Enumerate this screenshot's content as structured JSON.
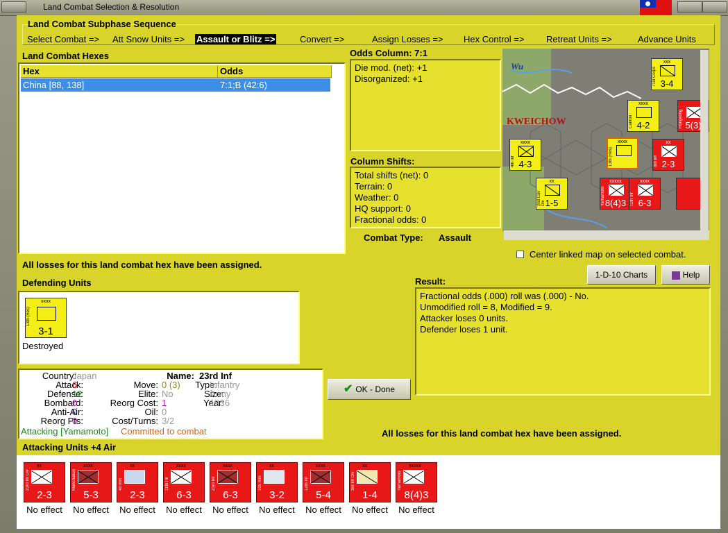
{
  "window": {
    "title": "Land Combat Selection & Resolution"
  },
  "subphase": {
    "heading": "Land Combat Subphase Sequence",
    "steps": [
      {
        "label": "Select Combat =>"
      },
      {
        "label": "Att Snow Units =>"
      },
      {
        "label": "Assault or Blitz =>",
        "active": true
      },
      {
        "label": "Convert =>"
      },
      {
        "label": "Assign Losses =>"
      },
      {
        "label": "Hex Control =>"
      },
      {
        "label": "Retreat Units =>"
      },
      {
        "label": "Advance Units"
      }
    ]
  },
  "hexes": {
    "heading": "Land Combat Hexes",
    "columns": [
      "Hex",
      "Odds"
    ],
    "rows": [
      {
        "hex": "China [88, 138]",
        "odds": "7:1;B (42:6)"
      }
    ]
  },
  "odds_column": {
    "heading": "Odds Column: 7:1",
    "lines": [
      "Die mod. (net): +1",
      "Disorganized: +1"
    ]
  },
  "column_shifts": {
    "heading": "Column Shifts:",
    "lines": [
      "Total shifts (net): 0",
      "Terrain: 0",
      "Weather: 0",
      "HQ support: 0",
      "Fractional odds: 0"
    ]
  },
  "combat_type": {
    "label": "Combat Type:",
    "value": "Assault"
  },
  "map": {
    "labels": [
      "Wu",
      "KWEICHOW"
    ],
    "counters": [
      {
        "color": "y",
        "size": "xxx",
        "name": "71st Corps",
        "str": "3-4",
        "badge": "2"
      },
      {
        "color": "y",
        "size": "xxxx",
        "name": "Canton",
        "str": "4-2",
        "badge": "2"
      },
      {
        "color": "r",
        "size": "",
        "name": "Hongkong",
        "str": "5(3)",
        "badge": "2"
      },
      {
        "color": "y",
        "size": "xxxx",
        "name": "4th Inf",
        "str": "4-3",
        "badge": ""
      },
      {
        "color": "y",
        "size": "xxxx",
        "name": "13th (Res)",
        "str": "",
        "badge": "3"
      },
      {
        "color": "r",
        "size": "xx",
        "name": "3rd Inf",
        "str": "2-3",
        "badge": ""
      },
      {
        "color": "y",
        "size": "xx",
        "name": "2nd Cav Div",
        "str": "1-5",
        "badge": ""
      },
      {
        "color": "r",
        "size": "xxxxx",
        "name": "Yamamoto",
        "str": "8(4)3",
        "badge": "3"
      },
      {
        "color": "r",
        "size": "xxxx",
        "name": "11th Inf",
        "str": "6-3",
        "badge": "3"
      },
      {
        "color": "r",
        "size": "",
        "name": "",
        "str": "",
        "badge": "2"
      }
    ],
    "center_linked_label": "Center linked map on selected combat."
  },
  "buttons": {
    "charts": "1-D-10 Charts",
    "help": "Help",
    "ok": "OK - Done"
  },
  "status_top": "All losses for this land combat hex have been assigned.",
  "status_bottom": "All losses for this land combat hex have been assigned.",
  "defending": {
    "heading": "Defending Units",
    "units": [
      {
        "size": "xxxx",
        "name": "13th (Res)",
        "str": "3-1",
        "effect": "Destroyed"
      }
    ]
  },
  "result": {
    "heading": "Result:",
    "lines": [
      "Fractional odds (.000) roll was (.000)  - No.",
      "Unmodified roll = 8, Modified = 9.",
      "Attacker loses 0 units.",
      "Defender loses 1 unit."
    ]
  },
  "unit_info": {
    "country_k": "Country:",
    "country_v": "Japan",
    "attack_k": "Attack:",
    "attack_v": "6",
    "defense_k": "Defense:",
    "defense_v": "12",
    "bombard_k": "Bombard:",
    "bombard_v": "0",
    "antiair_k": "Anti-Air:",
    "antiair_v": "0",
    "reorgpts_k": "Reorg Pts:",
    "reorgpts_v": "0",
    "name_k": "Name:",
    "name_v": "23rd Inf",
    "move_k": "Move:",
    "move_v": "0 (3)",
    "type_k": "Type:",
    "type_v": "Infantry",
    "elite_k": "Elite:",
    "elite_v": "No",
    "size_k": "Size:",
    "size_v": "Army",
    "reorgcost_k": "Reorg Cost:",
    "reorgcost_v": "1",
    "year_k": "Year:",
    "year_v": "1936",
    "oil_k": "Oil:",
    "oil_v": "0",
    "costturns_k": "Cost/Turns:",
    "costturns_v": "3/2",
    "attacking": "Attacking [Yamamoto]",
    "committed": "Committed to combat"
  },
  "attacking": {
    "heading": "Attacking Units +4 Air",
    "units": [
      {
        "size": "xx",
        "name": "23rd Inf Div",
        "str": "2-3",
        "effect": "No effect"
      },
      {
        "size": "xxxx",
        "name": "Manchukuo",
        "str": "5-3",
        "effect": "No effect"
      },
      {
        "size": "xx",
        "name": "40 mm",
        "str": "2-3",
        "effect": "No effect"
      },
      {
        "size": "xxxx",
        "name": "11th Inf",
        "str": "6-3",
        "effect": "No effect"
      },
      {
        "size": "xxxx",
        "name": "23rd Inf",
        "str": "6-3",
        "effect": "No effect"
      },
      {
        "size": "xx",
        "name": "105 mm",
        "str": "3-2",
        "effect": "No effect"
      },
      {
        "size": "xxxx",
        "name": "12th Inf",
        "str": "5-4",
        "effect": "No effect"
      },
      {
        "size": "xx",
        "name": "3rd Inf Div",
        "str": "1-4",
        "effect": "No effect"
      },
      {
        "size": "xxxxx",
        "name": "Yamamoto",
        "str": "8(4)3",
        "effect": "No effect"
      }
    ]
  },
  "colors": {
    "panel": "#d9d42a",
    "selected_row": "#3c8ee6",
    "allied_counter": "#f2ee16",
    "axis_counter": "#e81818"
  }
}
